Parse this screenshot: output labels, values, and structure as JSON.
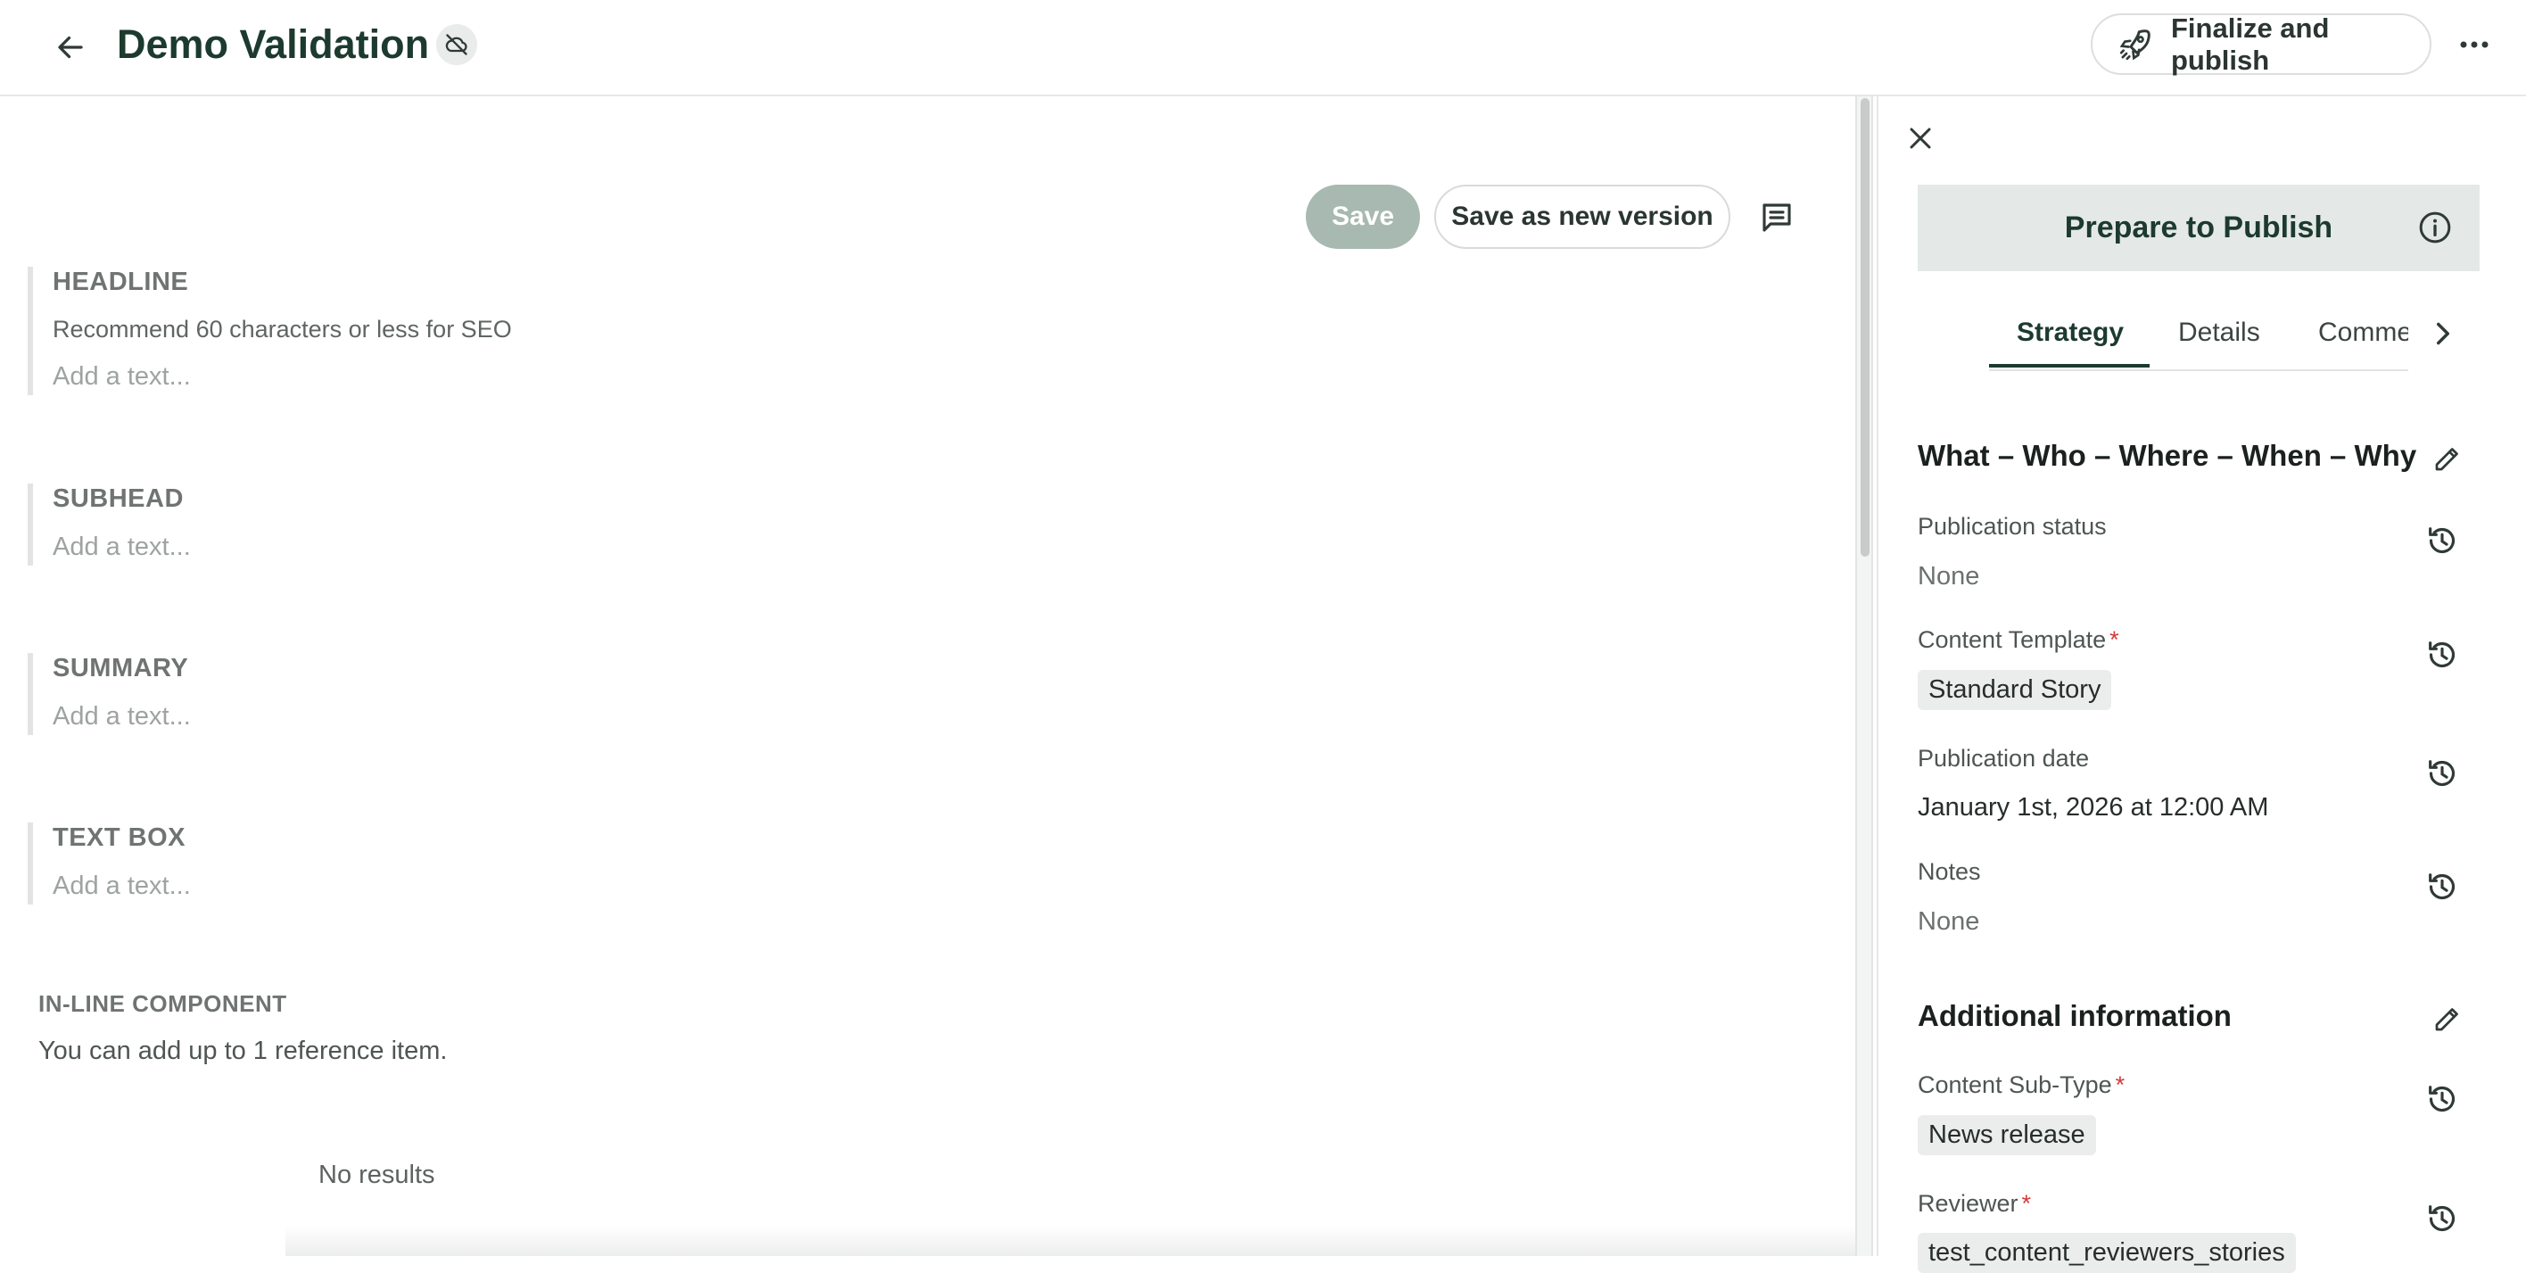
{
  "header": {
    "title": "Demo Validation",
    "finalize_label": "Finalize and publish"
  },
  "editor": {
    "save_label": "Save",
    "save_new_label": "Save as new version",
    "fields": [
      {
        "label": "HEADLINE",
        "hint": "Recommend 60 characters or less for SEO",
        "placeholder": "Add a text..."
      },
      {
        "label": "SUBHEAD",
        "placeholder": "Add a text..."
      },
      {
        "label": "SUMMARY",
        "placeholder": "Add a text..."
      },
      {
        "label": "TEXT BOX",
        "placeholder": "Add a text..."
      }
    ],
    "inline_component": {
      "label": "IN-LINE COMPONENT",
      "description": "You can add up to 1 reference item.",
      "empty_text": "No results"
    }
  },
  "panel": {
    "title": "Prepare to Publish",
    "tabs": [
      {
        "label": "Strategy",
        "active": true
      },
      {
        "label": "Details",
        "active": false
      },
      {
        "label": "Comments",
        "active": false
      }
    ],
    "section1": {
      "title": "What – Who – Where – When – Why",
      "items": [
        {
          "label": "Publication status",
          "value": "None",
          "required": false
        },
        {
          "label": "Content Template",
          "value": "Standard Story",
          "required": true
        },
        {
          "label": "Publication date",
          "value": "January 1st, 2026 at 12:00 AM",
          "required": false
        },
        {
          "label": "Notes",
          "value": "None",
          "required": false
        }
      ]
    },
    "section2": {
      "title": "Additional information",
      "items": [
        {
          "label": "Content Sub-Type",
          "value": "News release",
          "required": true
        },
        {
          "label": "Reviewer",
          "value": "test_content_reviewers_stories",
          "required": true
        }
      ]
    },
    "required_marker": "*"
  },
  "colors": {
    "brand_dark": "#1d3a2f",
    "save_disabled": "#a7b9b1",
    "required": "#d43a3a",
    "panel_header_bg": "#e4e9e7"
  }
}
